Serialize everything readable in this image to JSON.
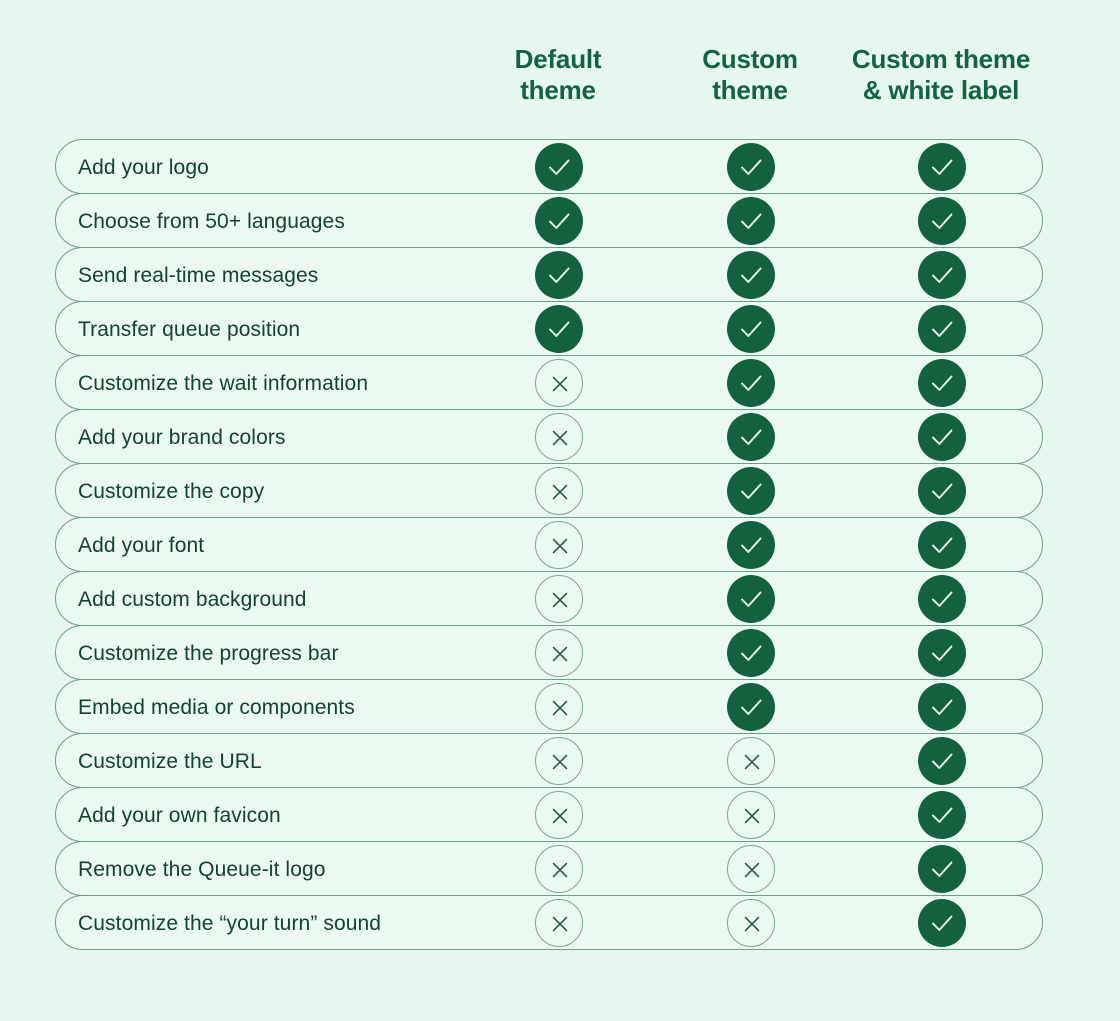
{
  "colors": {
    "page_background": "#e6f7ef",
    "row_background": "#eafaf1",
    "row_border": "#6f9e87",
    "header_text": "#13633f",
    "label_text": "#14432a",
    "yes_fill": "#14613f",
    "yes_glyph": "#eafaf1",
    "no_border": "#7ba694",
    "no_glyph": "#2f5e47"
  },
  "header": {
    "columns": [
      {
        "label": "Default\ntheme",
        "name": "default-theme"
      },
      {
        "label": "Custom\ntheme",
        "name": "custom-theme"
      },
      {
        "label": "Custom theme\n& white label",
        "name": "custom-theme-white-label"
      }
    ]
  },
  "icons": {
    "yes": "check-icon",
    "no": "cross-icon"
  },
  "rows": [
    {
      "label": "Add your logo",
      "values": [
        "yes",
        "yes",
        "yes"
      ]
    },
    {
      "label": "Choose from 50+ languages",
      "values": [
        "yes",
        "yes",
        "yes"
      ]
    },
    {
      "label": "Send real-time messages",
      "values": [
        "yes",
        "yes",
        "yes"
      ]
    },
    {
      "label": "Transfer queue position",
      "values": [
        "yes",
        "yes",
        "yes"
      ]
    },
    {
      "label": "Customize the wait information",
      "values": [
        "no",
        "yes",
        "yes"
      ]
    },
    {
      "label": "Add your brand colors",
      "values": [
        "no",
        "yes",
        "yes"
      ]
    },
    {
      "label": "Customize the copy",
      "values": [
        "no",
        "yes",
        "yes"
      ]
    },
    {
      "label": "Add your font",
      "values": [
        "no",
        "yes",
        "yes"
      ]
    },
    {
      "label": "Add custom background",
      "values": [
        "no",
        "yes",
        "yes"
      ]
    },
    {
      "label": "Customize the progress bar",
      "values": [
        "no",
        "yes",
        "yes"
      ]
    },
    {
      "label": "Embed media or components",
      "values": [
        "no",
        "yes",
        "yes"
      ]
    },
    {
      "label": "Customize the URL",
      "values": [
        "no",
        "no",
        "yes"
      ]
    },
    {
      "label": "Add your own favicon",
      "values": [
        "no",
        "no",
        "yes"
      ]
    },
    {
      "label": "Remove the Queue-it logo",
      "values": [
        "no",
        "no",
        "yes"
      ]
    },
    {
      "label": "Customize the “your turn” sound",
      "values": [
        "no",
        "no",
        "yes"
      ]
    }
  ]
}
